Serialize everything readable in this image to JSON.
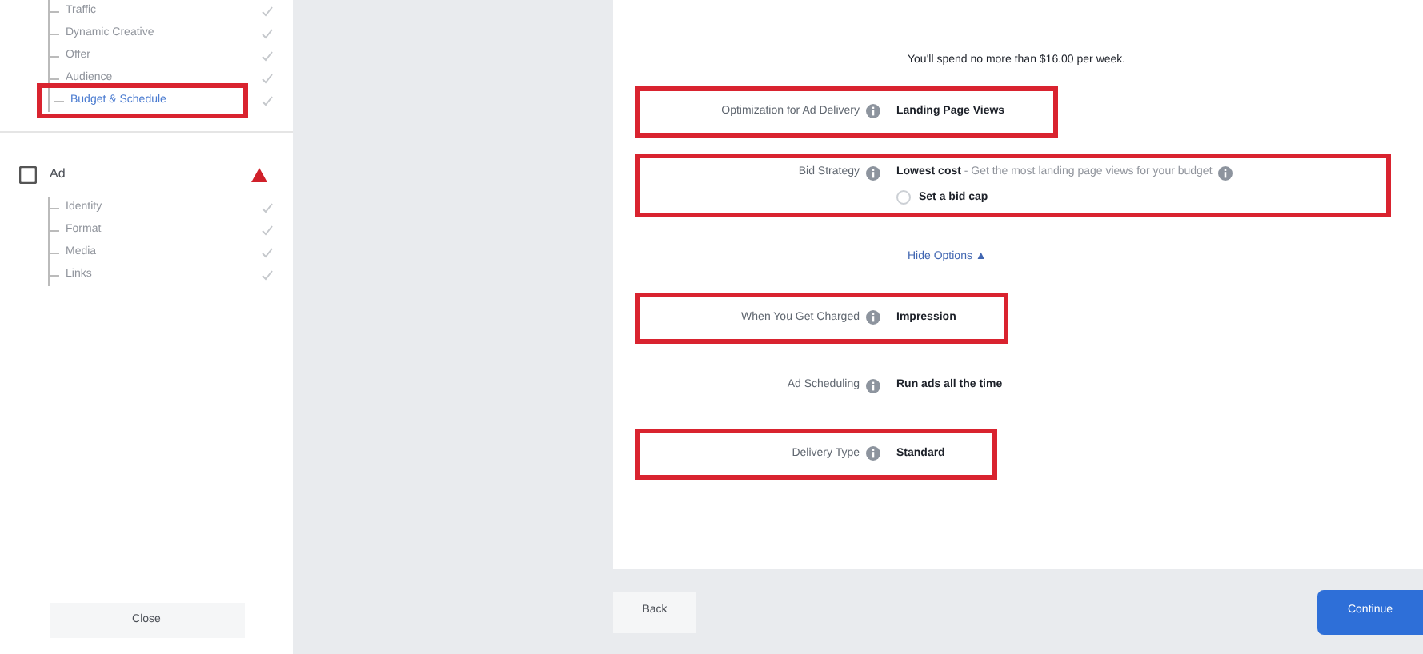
{
  "sidebar": {
    "groups": [
      {
        "items": [
          {
            "label": "Traffic",
            "selected": false,
            "done": true
          },
          {
            "label": "Dynamic Creative",
            "selected": false,
            "done": true
          },
          {
            "label": "Offer",
            "selected": false,
            "done": true
          },
          {
            "label": "Audience",
            "selected": false,
            "done": true
          },
          {
            "label": "Budget & Schedule",
            "selected": true,
            "done": true,
            "highlighted": true
          }
        ]
      },
      {
        "title": "Ad",
        "warning": true,
        "items": [
          {
            "label": "Identity",
            "selected": false,
            "done": true
          },
          {
            "label": "Format",
            "selected": false,
            "done": true
          },
          {
            "label": "Media",
            "selected": false,
            "done": true
          },
          {
            "label": "Links",
            "selected": false,
            "done": true
          }
        ]
      }
    ],
    "close_button": "Close"
  },
  "form": {
    "spend_note": "You'll spend no more than $16.00 per week.",
    "rows": [
      {
        "kind": "value",
        "label": "Optimization for Ad Delivery",
        "value": "Landing Page Views",
        "highlighted": true
      },
      {
        "kind": "bid",
        "label": "Bid Strategy",
        "value": "Lowest cost",
        "hint": "- Get the most landing page views for your budget",
        "option": "Set a bid cap",
        "selected": false,
        "highlighted": true
      },
      {
        "kind": "link",
        "value": "Hide Options ▲"
      },
      {
        "kind": "value",
        "label": "When You Get Charged",
        "value": "Impression",
        "highlighted": true
      },
      {
        "kind": "value",
        "label": "Ad Scheduling",
        "value": "Run ads all the time",
        "highlighted": false
      },
      {
        "kind": "value",
        "label": "Delivery Type",
        "value": "Standard",
        "highlighted": true
      }
    ]
  },
  "footer": {
    "back": "Back",
    "continue": "Continue"
  }
}
